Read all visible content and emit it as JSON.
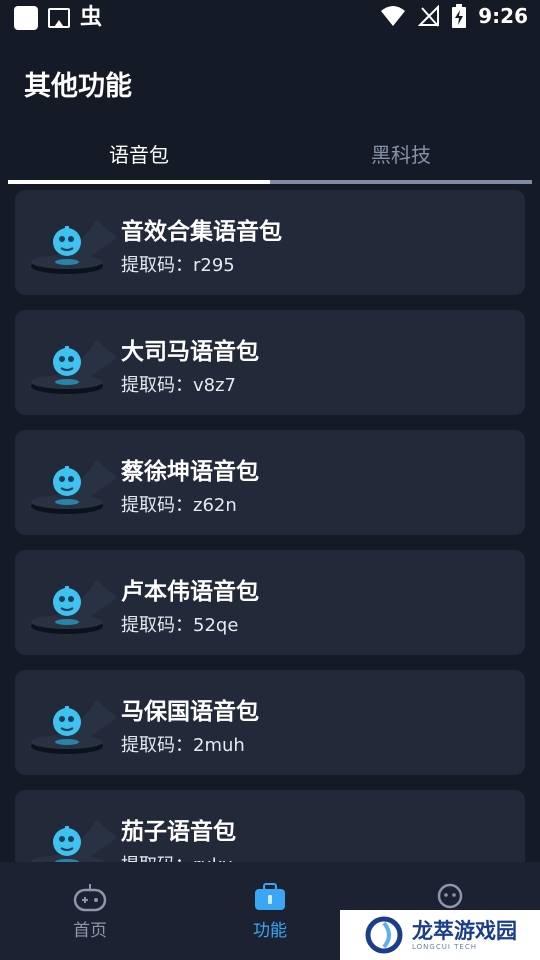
{
  "status_bar": {
    "time": "9:26",
    "left_icons": [
      "notification-square-icon",
      "image-icon",
      "bug-icon"
    ],
    "right_icons": [
      "wifi-icon",
      "no-signal-icon",
      "battery-charging-icon"
    ],
    "bug_glyph": "虫"
  },
  "page_title": "其他功能",
  "tabs": [
    {
      "label": "语音包",
      "active": true
    },
    {
      "label": "黑科技",
      "active": false
    }
  ],
  "voice_packs": [
    {
      "title": "音效合集语音包",
      "code": "提取码：r295"
    },
    {
      "title": "大司马语音包",
      "code": "提取码：v8z7"
    },
    {
      "title": "蔡徐坤语音包",
      "code": "提取码：z62n"
    },
    {
      "title": "卢本伟语音包",
      "code": "提取码：52qe"
    },
    {
      "title": "马保国语音包",
      "code": "提取码：2muh"
    },
    {
      "title": "茄子语音包",
      "code": "提取码：ruku"
    }
  ],
  "bottom_nav": {
    "home": "首页",
    "functions": "功能",
    "mine": "",
    "active": "functions"
  },
  "watermark": {
    "name": "龙萃游戏园",
    "sub": "LONGCUI TECH"
  },
  "colors": {
    "background": "#141a26",
    "card": "#222938",
    "accent": "#3aa6f4",
    "inactive": "#8b97ab"
  }
}
